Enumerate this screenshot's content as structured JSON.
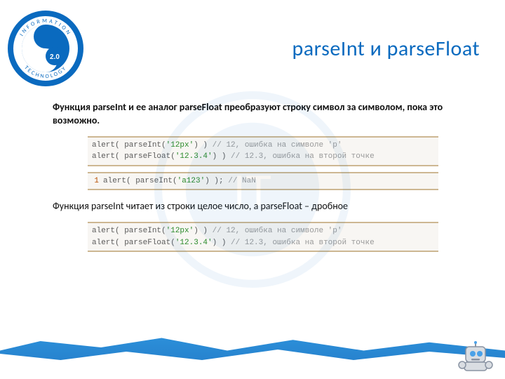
{
  "header": {
    "title": "parseInt и parseFloat",
    "logo_badge": "2.0",
    "logo_center": "IT",
    "logo_top_word": "INFORMATION",
    "logo_bottom_word": "TECHNOLOGY"
  },
  "content": {
    "para1": "Функция parseInt и ее аналог parseFloat преобразуют строку символ за символом, пока это возможно.",
    "para2": "Функция parseInt читает из строки целое число, а parseFloat – дробное",
    "code1": {
      "l1a": "alert( parseInt(",
      "l1s": "'12px'",
      "l1b": ") ) ",
      "l1c": "// 12, ошибка на символе 'p'",
      "l2a": "alert( parseFloat(",
      "l2s": "'12.3.4'",
      "l2b": ") ) ",
      "l2c": "// 12.3, ошибка на второй точке"
    },
    "code2": {
      "ln": "1",
      "a": "alert( parseInt(",
      "s": "'a123'",
      "b": ") ); ",
      "c": "// NaN"
    },
    "code3": {
      "l1a": "alert( parseInt(",
      "l1s": "'12px'",
      "l1b": ") ) ",
      "l1c": "// 12, ошибка на символе 'p'",
      "l2a": "alert( parseFloat(",
      "l2s": "'12.3.4'",
      "l2b": ") ) ",
      "l2c": "// 12.3, ошибка на второй точке"
    }
  }
}
